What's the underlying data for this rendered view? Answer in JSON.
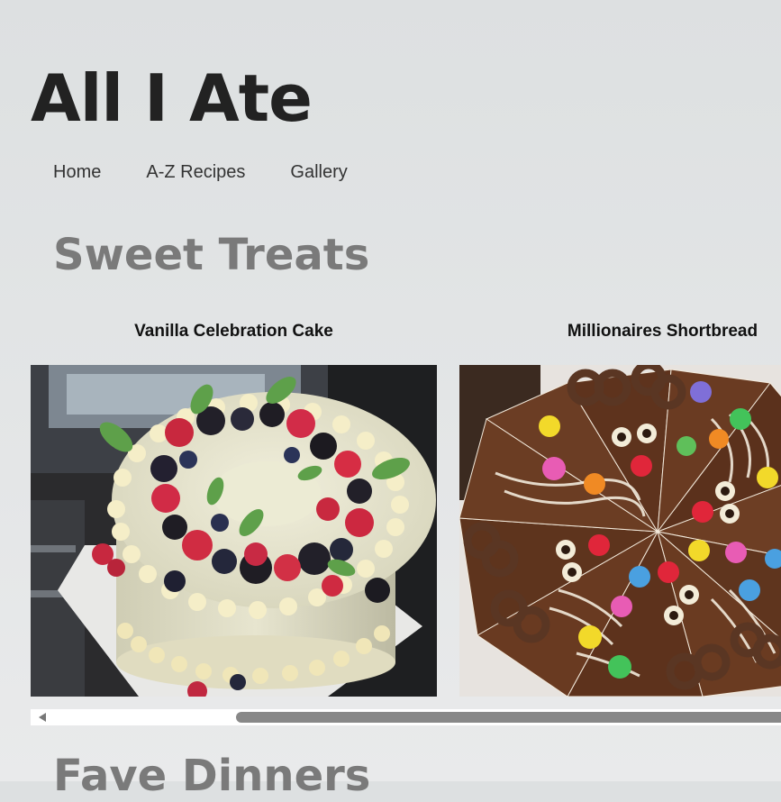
{
  "site": {
    "title": "All I Ate"
  },
  "nav": {
    "items": [
      {
        "label": "Home"
      },
      {
        "label": "A-Z Recipes"
      },
      {
        "label": "Gallery"
      }
    ]
  },
  "sections": [
    {
      "title": "Sweet Treats",
      "cards": [
        {
          "caption": "Vanilla Celebration Cake",
          "image": "cake-photo"
        },
        {
          "caption": "Millionaires Shortbread",
          "image": "shortbread-photo"
        }
      ]
    },
    {
      "title": "Fave Dinners"
    }
  ],
  "icons": {
    "scroll_left": "triangle-left-icon"
  },
  "colors": {
    "background": "#dde0e1",
    "heading": "#7a7a7a",
    "title": "#222222",
    "scrollbar_thumb": "#888888"
  }
}
